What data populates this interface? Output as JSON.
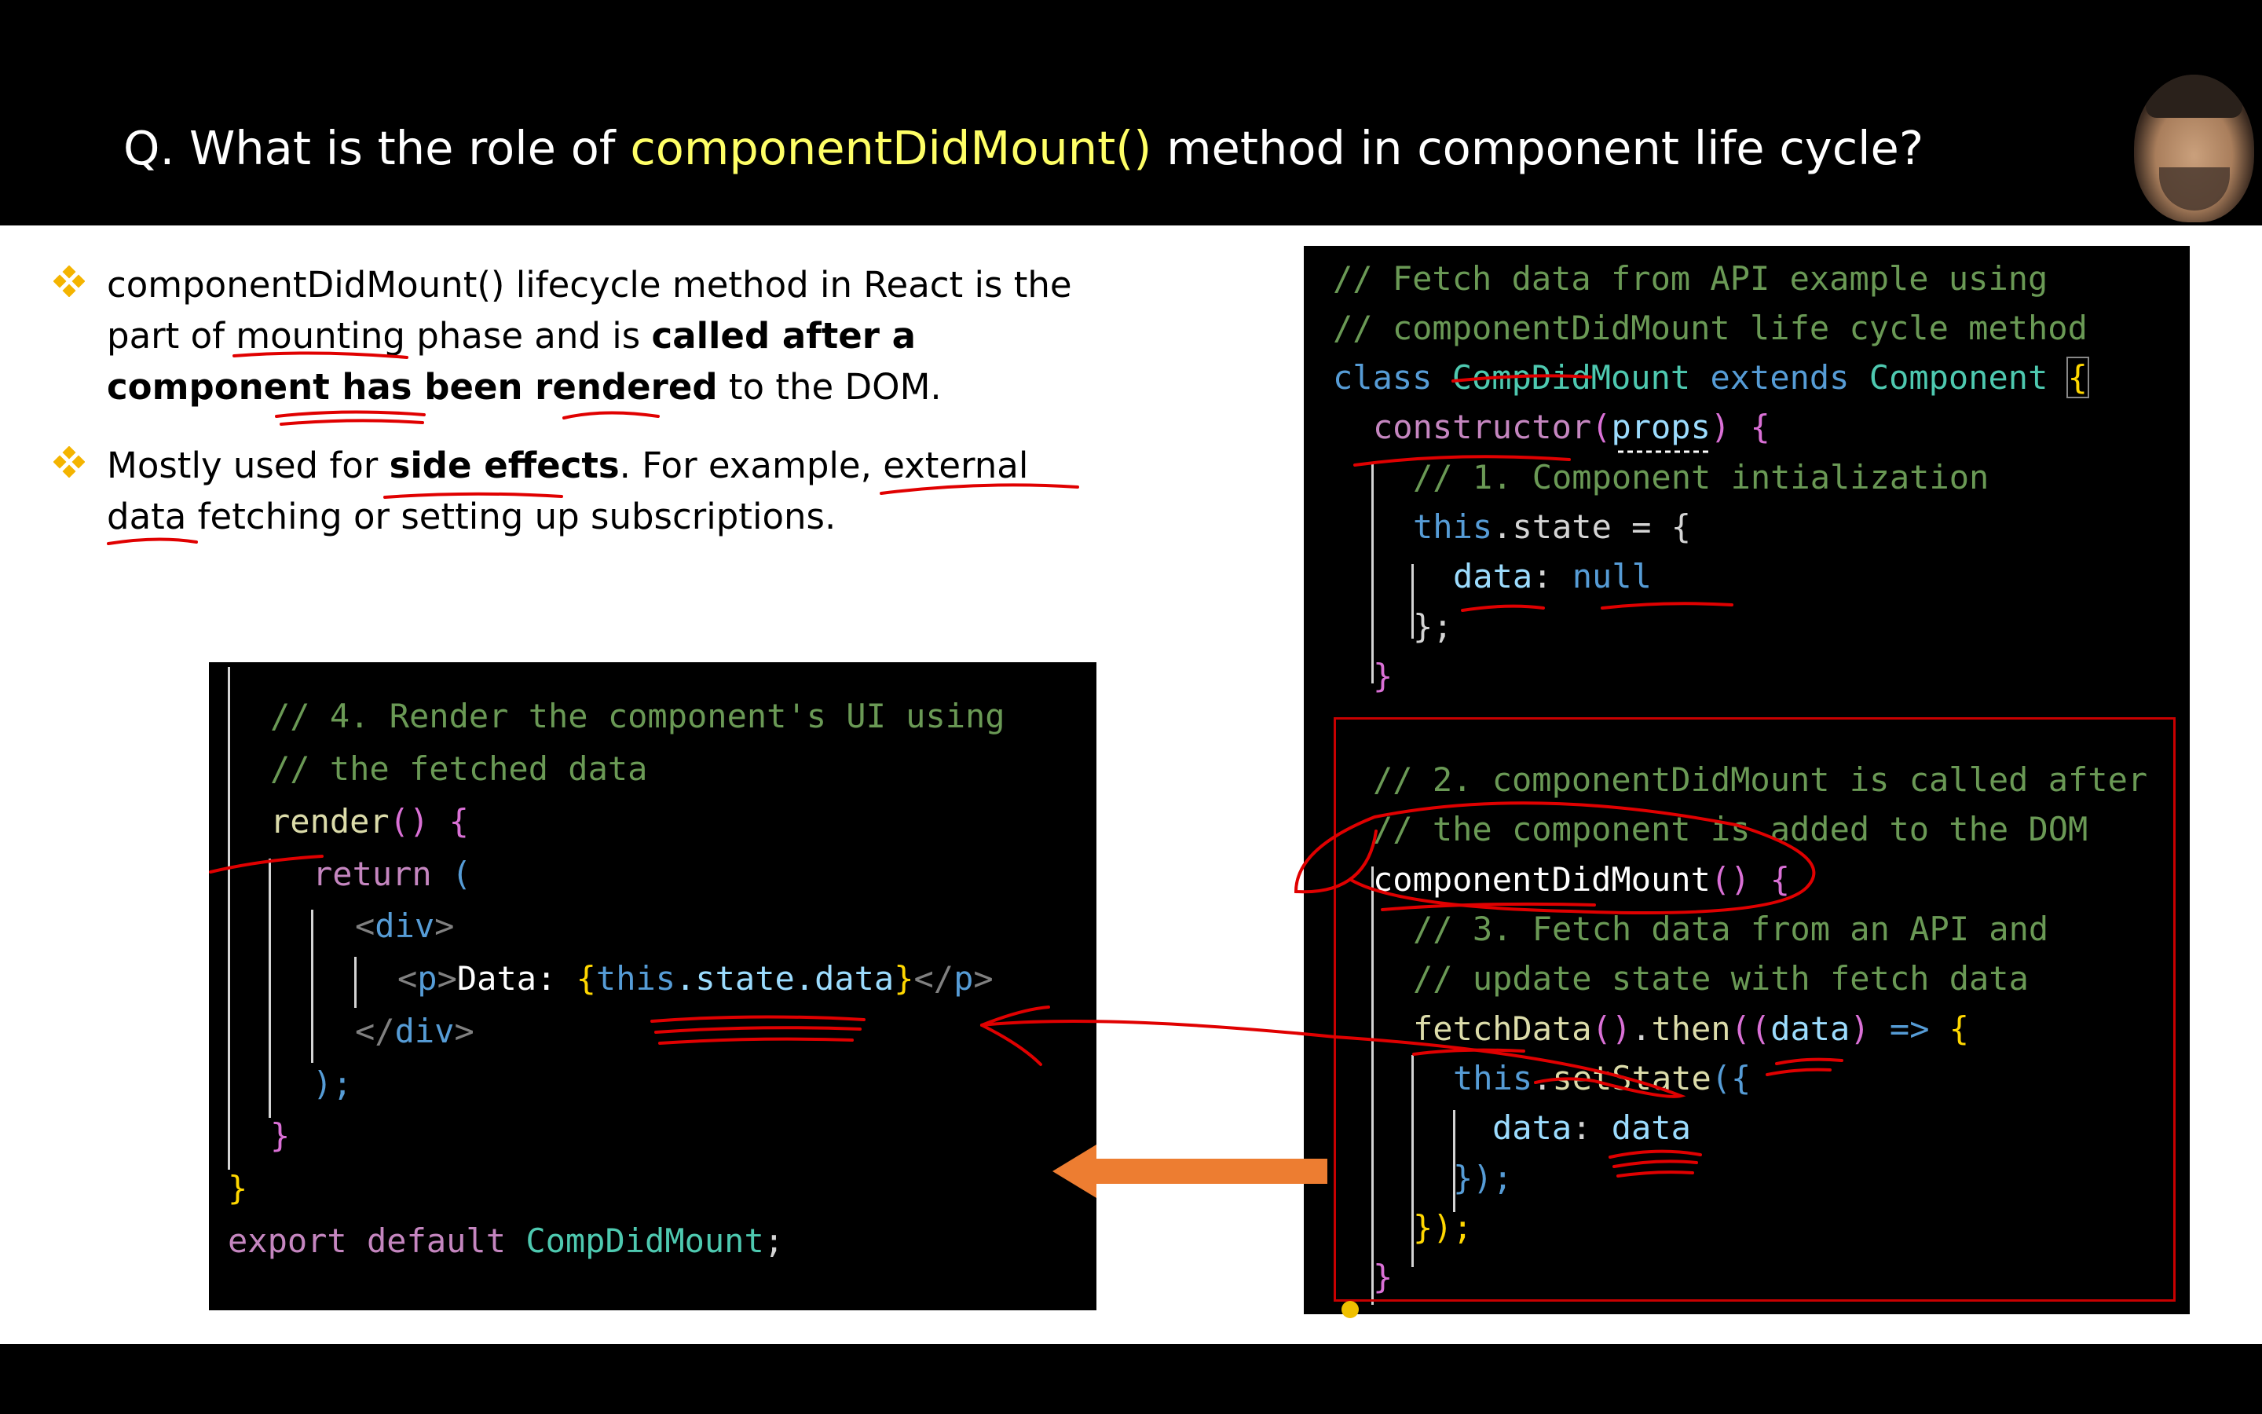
{
  "slide": {
    "title_prefix": "Q. What is the role of ",
    "title_highlight": "componentDidMount()",
    "title_suffix": " method in component life cycle?",
    "bullets": [
      {
        "p1": "componentDidMount() lifecycle method in React is the part of mounting phase and is ",
        "bold": "called after a component has been rendered",
        "p2": " to the DOM."
      },
      {
        "p1": "Mostly used for ",
        "bold": "side effects",
        "p2": ". For example, external data fetching or setting up subscriptions."
      }
    ]
  },
  "right_code": {
    "l1": "// Fetch data from API example using",
    "l2": "// componentDidMount life cycle method",
    "l3_kw": "class",
    "l3_name": "CompDidMount",
    "l3_ext": "extends",
    "l3_base": "Component",
    "l3_brace": "{",
    "l4_fn": "constructor",
    "l4_open": "(",
    "l4_param": "props",
    "l4_close": ")",
    "l4_brace": "{",
    "l5": "// 1. Component intialization",
    "l6_this": "this",
    "l6_rest": ".state = {",
    "l7_key": "data",
    "l7_colon": ": ",
    "l7_val": "null",
    "l8": "};",
    "l9": "}",
    "l10": "// 2. componentDidMount is called after",
    "l11": "// the component is added to the DOM",
    "l12_fn": "componentDidMount",
    "l12_paren": "()",
    "l12_brace": "{",
    "l13": "// 3. Fetch data from an API and",
    "l14": "// update state with fetch data",
    "l15_fn": "fetchData",
    "l15_p1": "()",
    "l15_dot": ".",
    "l15_then": "then",
    "l15_open": "((",
    "l15_arg": "data",
    "l15_close": ")",
    "l15_arrow": " => ",
    "l15_brace": "{",
    "l16_this": "this",
    "l16_dot": ".",
    "l16_fn": "setState",
    "l16_open": "({",
    "l17_key": "data",
    "l17_colon": ": ",
    "l17_val": "data",
    "l18": "});",
    "l19": "});",
    "l20": "}"
  },
  "left_code": {
    "l1": "// 4. Render the component's UI using",
    "l2": "// the fetched data",
    "l3_fn": "render",
    "l3_paren": "()",
    "l3_brace": "{",
    "l4_kw": "return",
    "l4_paren": "(",
    "l5_open": "<",
    "l5_tag": "div",
    "l5_close": ">",
    "l6_open": "<",
    "l6_tag": "p",
    "l6_close": ">",
    "l6_text": "Data: ",
    "l6_b1": "{",
    "l6_this": "this",
    "l6_path": ".state.data",
    "l6_b2": "}",
    "l6_end_open": "</",
    "l6_end_tag": "p",
    "l6_end_close": ">",
    "l7_open": "</",
    "l7_tag": "div",
    "l7_close": ">",
    "l8": ");",
    "l9": "}",
    "l10": "}",
    "l11_kw": "export default",
    "l11_name": "CompDidMount",
    "l11_semi": ";"
  }
}
